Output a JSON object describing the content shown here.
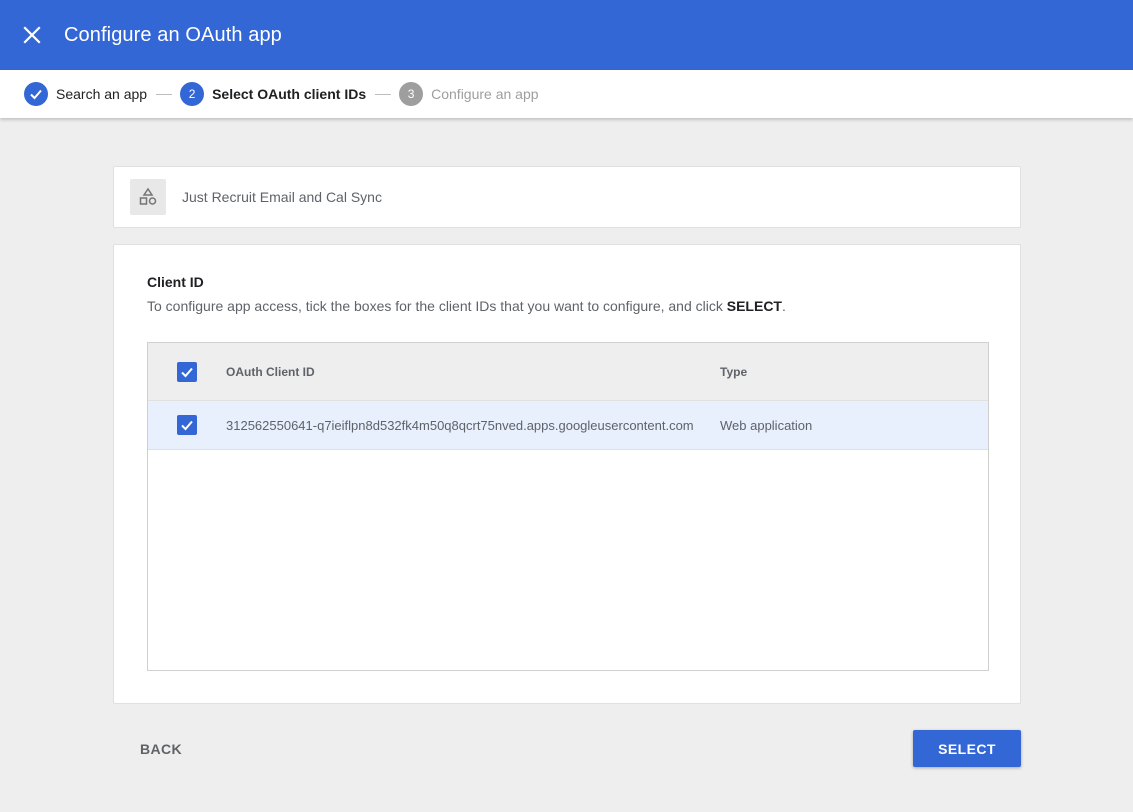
{
  "header": {
    "title": "Configure an OAuth app",
    "close_icon": "close-icon",
    "color": "#3367d6"
  },
  "stepper": {
    "steps": [
      {
        "label": "Search an app",
        "status": "done",
        "icon": "check-icon"
      },
      {
        "label": "Select OAuth client IDs",
        "status": "active",
        "number": "2"
      },
      {
        "label": "Configure an app",
        "status": "pending",
        "number": "3"
      }
    ]
  },
  "app": {
    "name": "Just Recruit Email and Cal Sync",
    "icon": "app-shapes-icon"
  },
  "client_section": {
    "title": "Client ID",
    "description_prefix": "To configure app access, tick the boxes for the client IDs that you want to configure, and click ",
    "description_action": "SELECT",
    "description_suffix": "."
  },
  "table": {
    "columns": [
      "OAuth Client ID",
      "Type"
    ],
    "select_all_checked": true,
    "rows": [
      {
        "checked": true,
        "client_id": "312562550641-q7ieiflpn8d532fk4m50q8qcrt75nved.apps.googleusercontent.com",
        "type": "Web application"
      }
    ]
  },
  "footer": {
    "back_label": "BACK",
    "select_label": "SELECT"
  }
}
